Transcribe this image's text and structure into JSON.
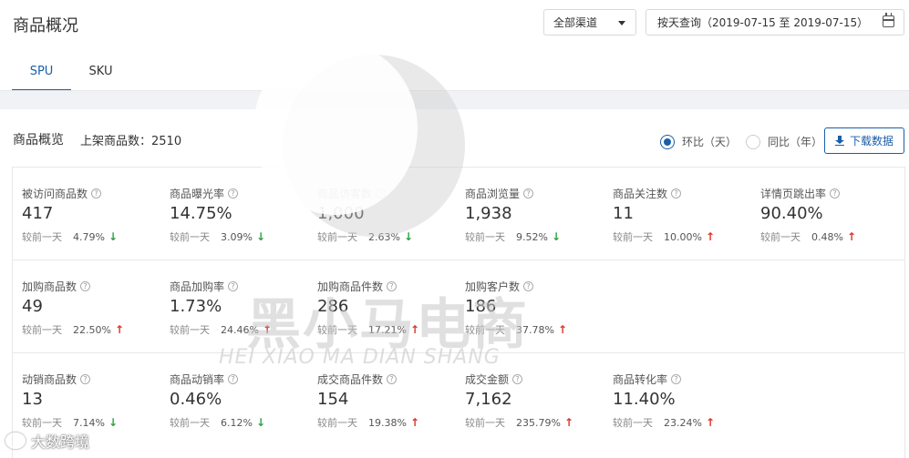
{
  "header": {
    "title": "商品概况",
    "channel_select": "全部渠道",
    "date_range": "按天查询（2019-07-15 至 2019-07-15）",
    "tabs": [
      {
        "label": "SPU",
        "active": true
      },
      {
        "label": "SKU",
        "active": false
      }
    ]
  },
  "panel": {
    "title": "商品概览",
    "count_label": "上架商品数：2510",
    "radios": [
      {
        "label": "环比（天）",
        "selected": true
      },
      {
        "label": "同比（年）",
        "selected": false
      }
    ],
    "download_label": "下载数据",
    "compare_prefix": "较前一天",
    "rows": [
      [
        {
          "label": "被访问商品数",
          "value": "417",
          "pct": "4.79%",
          "trend": "down"
        },
        {
          "label": "商品曝光率",
          "value": "14.75%",
          "pct": "3.09%",
          "trend": "down"
        },
        {
          "label": "商品访客数",
          "value": "1,000",
          "pct": "2.63%",
          "trend": "down"
        },
        {
          "label": "商品浏览量",
          "value": "1,938",
          "pct": "9.52%",
          "trend": "down"
        },
        {
          "label": "商品关注数",
          "value": "11",
          "pct": "10.00%",
          "trend": "up"
        },
        {
          "label": "详情页跳出率",
          "value": "90.40%",
          "pct": "0.48%",
          "trend": "up"
        }
      ],
      [
        {
          "label": "加购商品数",
          "value": "49",
          "pct": "22.50%",
          "trend": "up"
        },
        {
          "label": "商品加购率",
          "value": "1.73%",
          "pct": "24.46%",
          "trend": "up"
        },
        {
          "label": "加购商品件数",
          "value": "286",
          "pct": "17.21%",
          "trend": "up"
        },
        {
          "label": "加购客户数",
          "value": "186",
          "pct": "37.78%",
          "trend": "up"
        }
      ],
      [
        {
          "label": "动销商品数",
          "value": "13",
          "pct": "7.14%",
          "trend": "down"
        },
        {
          "label": "商品动销率",
          "value": "0.46%",
          "pct": "6.12%",
          "trend": "down"
        },
        {
          "label": "成交商品件数",
          "value": "154",
          "pct": "19.38%",
          "trend": "up"
        },
        {
          "label": "成交金额",
          "value": "7,162",
          "pct": "235.79%",
          "trend": "up"
        },
        {
          "label": "商品转化率",
          "value": "11.40%",
          "pct": "23.24%",
          "trend": "up"
        }
      ]
    ]
  },
  "watermark": {
    "brand": "黑小马电商",
    "pinyin": "HEI XIAO MA DIAN SHANG",
    "corner": "大数跨境"
  },
  "colors": {
    "accent": "#1a5ea8",
    "up": "#d9342b",
    "down": "#2ea043"
  }
}
